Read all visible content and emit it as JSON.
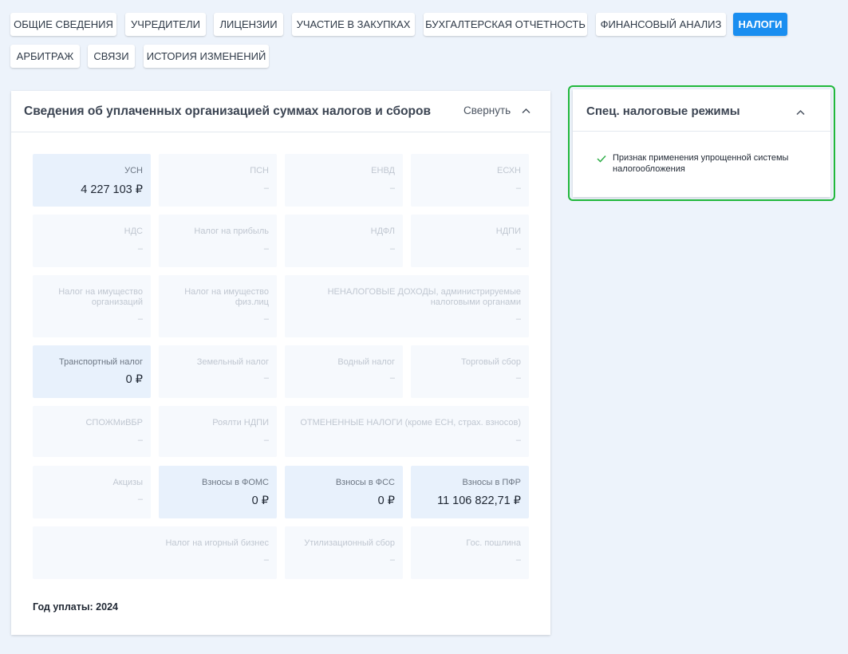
{
  "tabs": [
    {
      "label": "ОБЩИЕ СВЕДЕНИЯ",
      "active": false
    },
    {
      "label": "УЧРЕДИТЕЛИ",
      "active": false
    },
    {
      "label": "ЛИЦЕНЗИИ",
      "active": false
    },
    {
      "label": "УЧАСТИЕ В ЗАКУПКАХ",
      "active": false
    },
    {
      "label": "БУХГАЛТЕРСКАЯ ОТЧЕТНОСТЬ",
      "active": false
    },
    {
      "label": "ФИНАНСОВЫЙ АНАЛИЗ",
      "active": false
    },
    {
      "label": "НАЛОГИ",
      "active": true
    },
    {
      "label": "АРБИТРАЖ",
      "active": false
    },
    {
      "label": "СВЯЗИ",
      "active": false
    },
    {
      "label": "ИСТОРИЯ ИЗМЕНЕНИЙ",
      "active": false
    }
  ],
  "taxes_card": {
    "title": "Сведения об уплаченных организацией суммах налогов и сборов",
    "collapse_label": "Свернуть",
    "collapse_icon": "chevron-up-icon",
    "year_label": "Год уплаты: 2024",
    "items": [
      {
        "label": "УСН",
        "value": "4 227 103 ₽",
        "active": true
      },
      {
        "label": "ПСН",
        "value": "–",
        "active": false
      },
      {
        "label": "ЕНВД",
        "value": "–",
        "active": false
      },
      {
        "label": "ЕСХН",
        "value": "–",
        "active": false
      },
      {
        "label": "НДС",
        "value": "–",
        "active": false
      },
      {
        "label": "Налог на прибыль",
        "value": "–",
        "active": false
      },
      {
        "label": "НДФЛ",
        "value": "–",
        "active": false
      },
      {
        "label": "НДПИ",
        "value": "–",
        "active": false
      },
      {
        "label": "Налог на имущество организаций",
        "value": "–",
        "active": false
      },
      {
        "label": "Налог на имущество физ.лиц",
        "value": "–",
        "active": false
      },
      {
        "label": "НЕНАЛОГОВЫЕ ДОХОДЫ, администрируемые налоговыми органами",
        "value": "–",
        "active": false
      },
      {
        "label": "Транспортный налог",
        "value": "0 ₽",
        "active": true
      },
      {
        "label": "Земельный налог",
        "value": "–",
        "active": false
      },
      {
        "label": "Водный налог",
        "value": "–",
        "active": false
      },
      {
        "label": "Торговый сбор",
        "value": "–",
        "active": false
      },
      {
        "label": "СПОЖМиВБР",
        "value": "–",
        "active": false
      },
      {
        "label": "Роялти НДПИ",
        "value": "–",
        "active": false
      },
      {
        "label": "ОТМЕНЕННЫЕ НАЛОГИ (кроме ЕСН, страх. взносов)",
        "value": "–",
        "active": false
      },
      {
        "label": "Акцизы",
        "value": "–",
        "active": false
      },
      {
        "label": "Взносы в ФОМС",
        "value": "0 ₽",
        "active": true
      },
      {
        "label": "Взносы в ФСС",
        "value": "0 ₽",
        "active": true
      },
      {
        "label": "Взносы в ПФР",
        "value": "11 106 822,71 ₽",
        "active": true
      },
      {
        "label": "Налог на игорный бизнес",
        "value": "–",
        "active": false
      },
      {
        "label": "Утилизационный сбор",
        "value": "–",
        "active": false
      },
      {
        "label": "Гос. пошлина",
        "value": "–",
        "active": false
      }
    ]
  },
  "spec_card": {
    "title": "Спец. налоговые режимы",
    "collapse_icon": "chevron-up-icon",
    "items": [
      {
        "icon": "checkmark-icon",
        "text": "Признак применения упрощенной системы налогообложения"
      }
    ]
  },
  "colors": {
    "background": "#edf3fb",
    "active_tab": "#1a8ef0",
    "highlight_outline": "#21b83c",
    "check": "#2fae48"
  }
}
